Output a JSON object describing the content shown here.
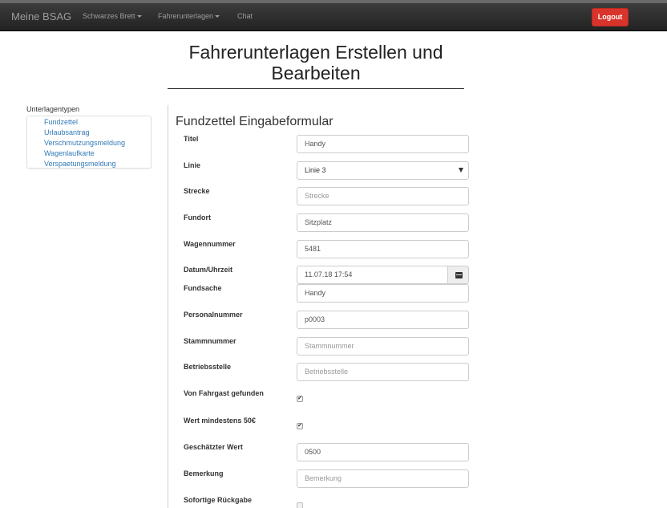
{
  "navbar": {
    "brand": "Meine BSAG",
    "items": [
      {
        "label": "Schwarzes Brett",
        "dropdown": true
      },
      {
        "label": "Fahrerunterlagen",
        "dropdown": true
      },
      {
        "label": "Chat",
        "dropdown": false
      }
    ],
    "logout_label": "Logout"
  },
  "page": {
    "title_line1": "Fahrerunterlagen Erstellen und",
    "title_line2": "Bearbeiten"
  },
  "sidebar": {
    "title": "Unterlagentypen",
    "items": [
      "Fundzettel",
      "Urlaubsantrag",
      "Verschmutzungsmeldung",
      "Wagenlaufkarte",
      "Verspaetungsmeldung"
    ]
  },
  "form": {
    "title": "Fundzettel Eingabeformular",
    "fields": {
      "titel": {
        "label": "Titel",
        "value": "Handy",
        "placeholder": ""
      },
      "linie": {
        "label": "Linie",
        "value": "Linie 3"
      },
      "strecke": {
        "label": "Strecke",
        "value": "",
        "placeholder": "Strecke"
      },
      "fundort": {
        "label": "Fundort",
        "value": "Sitzplatz",
        "placeholder": ""
      },
      "wagennummer": {
        "label": "Wagennummer",
        "value": "5481",
        "placeholder": ""
      },
      "datum": {
        "label": "Datum/Uhrzeit",
        "value": "11.07.18 17:54"
      },
      "fundsache": {
        "label": "Fundsache",
        "value": "Handy",
        "placeholder": ""
      },
      "personalnummer": {
        "label": "Personalnummer",
        "value": "p0003",
        "placeholder": ""
      },
      "stammnummer": {
        "label": "Stammnummer",
        "value": "",
        "placeholder": "Stammnummer"
      },
      "betriebsstelle": {
        "label": "Betriebsstelle",
        "value": "",
        "placeholder": "Betriebsstelle"
      },
      "fahrgast": {
        "label": "Von Fahrgast gefunden",
        "checked": true
      },
      "wert50": {
        "label": "Wert mindestens 50€",
        "checked": true
      },
      "geschaetzt": {
        "label": "Geschätzter Wert",
        "value": "0500",
        "placeholder": ""
      },
      "bemerkung": {
        "label": "Bemerkung",
        "value": "",
        "placeholder": "Bemerkung"
      },
      "rueckgabe": {
        "label": "Sofortige Rückgabe",
        "checked": false
      }
    }
  },
  "icons": {
    "calendar": "calendar-icon",
    "select_arrow": "chevron-down-icon",
    "check": "✔"
  },
  "colors": {
    "navbar": "#222222",
    "logout": "#d9342b",
    "link": "#337ab7"
  }
}
